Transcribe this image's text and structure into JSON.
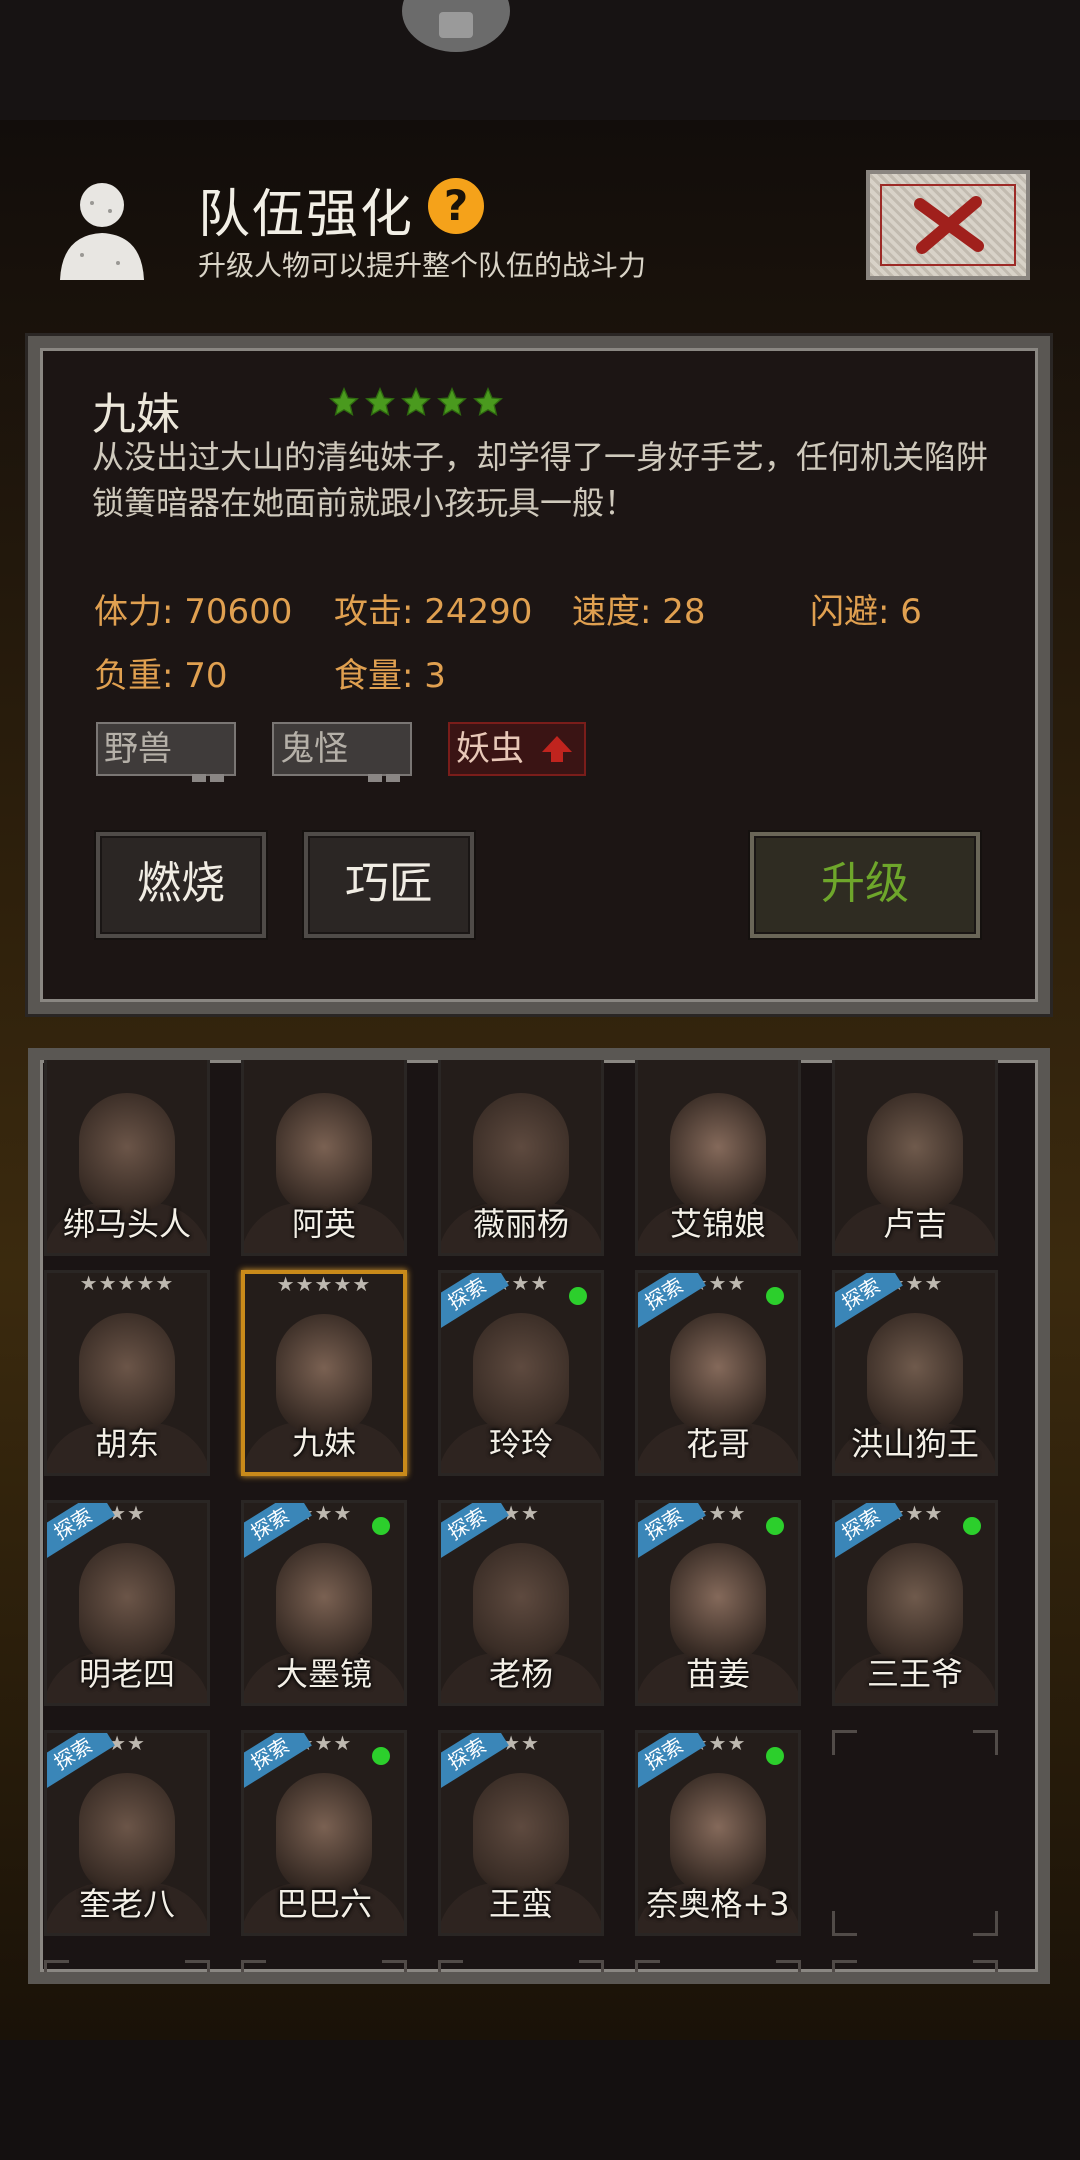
{
  "header": {
    "title": "队伍强化",
    "help_icon": "?",
    "subtitle": "升级人物可以提升整个队伍的战斗力",
    "avatar_icon": "person-silhouette-icon",
    "close_icon": "close-x-icon"
  },
  "character": {
    "name": "九妹",
    "stars": 5,
    "description": "从没出过大山的清纯妹子，却学得了一身好手艺，任何机关陷阱锁簧暗器在她面前就跟小孩玩具一般！",
    "stats": [
      {
        "label": "体力: 70600"
      },
      {
        "label": "攻击: 24290"
      },
      {
        "label": "速度: 28"
      },
      {
        "label": "闪避: 6"
      },
      {
        "label": "负重: 70"
      },
      {
        "label": "食量: 3"
      }
    ],
    "tags": [
      {
        "label": "野兽",
        "state": "neutral"
      },
      {
        "label": "鬼怪",
        "state": "neutral"
      },
      {
        "label": "妖虫",
        "state": "boosted"
      }
    ]
  },
  "actions": {
    "burn_label": "燃烧",
    "craftsman_label": "巧匠",
    "upgrade_label": "升级"
  },
  "colors": {
    "stat_text": "#e0a050",
    "upgrade_text": "#6ea62b",
    "selected_border": "#c98a1a",
    "explore_badge": "#3a86b8",
    "online_dot": "#2ccf2c"
  },
  "roster": [
    {
      "name": "绑马头人",
      "stars": "",
      "explore": false,
      "online": false
    },
    {
      "name": "阿英",
      "stars": "",
      "explore": false,
      "online": false
    },
    {
      "name": "薇丽杨",
      "stars": "",
      "explore": false,
      "online": false
    },
    {
      "name": "艾锦娘",
      "stars": "",
      "explore": false,
      "online": false
    },
    {
      "name": "卢吉",
      "stars": "",
      "explore": false,
      "online": false
    },
    {
      "name": "胡东",
      "stars": "★★★★★",
      "explore": false,
      "online": false
    },
    {
      "name": "九妹",
      "stars": "★★★★★",
      "explore": false,
      "online": false,
      "selected": true
    },
    {
      "name": "玲玲",
      "stars": "★★★",
      "explore": true,
      "online": true
    },
    {
      "name": "花哥",
      "stars": "★★★",
      "explore": true,
      "online": true
    },
    {
      "name": "洪山狗王",
      "stars": "★★★",
      "explore": true,
      "online": false
    },
    {
      "name": "明老四",
      "stars": "★★",
      "explore": true,
      "online": false
    },
    {
      "name": "大墨镜",
      "stars": "★★★",
      "explore": true,
      "online": true
    },
    {
      "name": "老杨",
      "stars": "★★",
      "explore": true,
      "online": false
    },
    {
      "name": "苗姜",
      "stars": "★★★",
      "explore": true,
      "online": true
    },
    {
      "name": "三王爷",
      "stars": "★★★",
      "explore": true,
      "online": true
    },
    {
      "name": "奎老八",
      "stars": "★★",
      "explore": true,
      "online": false
    },
    {
      "name": "巴巴六",
      "stars": "★★★",
      "explore": true,
      "online": true
    },
    {
      "name": "王蛮",
      "stars": "★★",
      "explore": true,
      "online": false
    },
    {
      "name": "奈奥格+3",
      "stars": "★★★",
      "explore": true,
      "online": true
    }
  ],
  "explore_badge_label": "探索"
}
